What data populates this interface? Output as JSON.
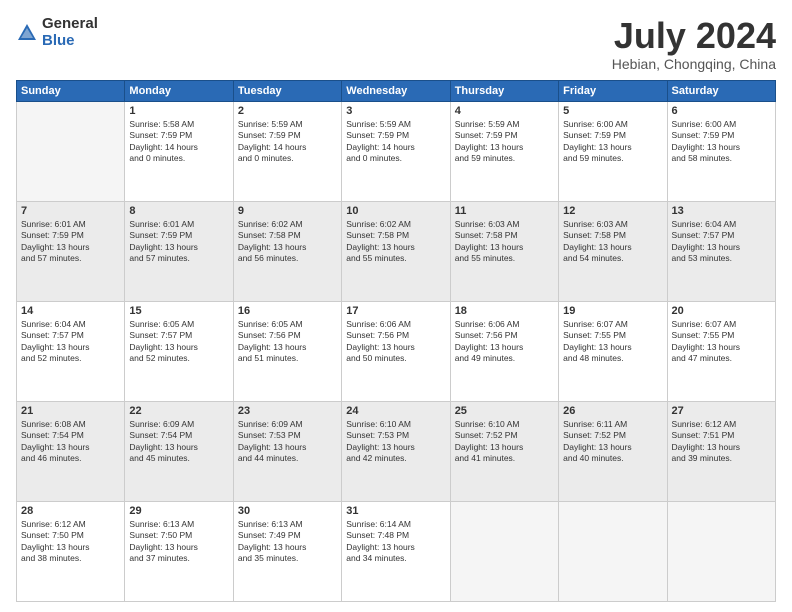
{
  "logo": {
    "general": "General",
    "blue": "Blue"
  },
  "title": {
    "month_year": "July 2024",
    "location": "Hebian, Chongqing, China"
  },
  "headers": [
    "Sunday",
    "Monday",
    "Tuesday",
    "Wednesday",
    "Thursday",
    "Friday",
    "Saturday"
  ],
  "weeks": [
    [
      {
        "day": "",
        "sunrise": "",
        "sunset": "",
        "daylight": ""
      },
      {
        "day": "1",
        "sunrise": "Sunrise: 5:58 AM",
        "sunset": "Sunset: 7:59 PM",
        "daylight": "Daylight: 14 hours and 0 minutes."
      },
      {
        "day": "2",
        "sunrise": "Sunrise: 5:59 AM",
        "sunset": "Sunset: 7:59 PM",
        "daylight": "Daylight: 14 hours and 0 minutes."
      },
      {
        "day": "3",
        "sunrise": "Sunrise: 5:59 AM",
        "sunset": "Sunset: 7:59 PM",
        "daylight": "Daylight: 14 hours and 0 minutes."
      },
      {
        "day": "4",
        "sunrise": "Sunrise: 5:59 AM",
        "sunset": "Sunset: 7:59 PM",
        "daylight": "Daylight: 13 hours and 59 minutes."
      },
      {
        "day": "5",
        "sunrise": "Sunrise: 6:00 AM",
        "sunset": "Sunset: 7:59 PM",
        "daylight": "Daylight: 13 hours and 59 minutes."
      },
      {
        "day": "6",
        "sunrise": "Sunrise: 6:00 AM",
        "sunset": "Sunset: 7:59 PM",
        "daylight": "Daylight: 13 hours and 58 minutes."
      }
    ],
    [
      {
        "day": "7",
        "sunrise": "Sunrise: 6:01 AM",
        "sunset": "Sunset: 7:59 PM",
        "daylight": "Daylight: 13 hours and 57 minutes."
      },
      {
        "day": "8",
        "sunrise": "Sunrise: 6:01 AM",
        "sunset": "Sunset: 7:59 PM",
        "daylight": "Daylight: 13 hours and 57 minutes."
      },
      {
        "day": "9",
        "sunrise": "Sunrise: 6:02 AM",
        "sunset": "Sunset: 7:58 PM",
        "daylight": "Daylight: 13 hours and 56 minutes."
      },
      {
        "day": "10",
        "sunrise": "Sunrise: 6:02 AM",
        "sunset": "Sunset: 7:58 PM",
        "daylight": "Daylight: 13 hours and 55 minutes."
      },
      {
        "day": "11",
        "sunrise": "Sunrise: 6:03 AM",
        "sunset": "Sunset: 7:58 PM",
        "daylight": "Daylight: 13 hours and 55 minutes."
      },
      {
        "day": "12",
        "sunrise": "Sunrise: 6:03 AM",
        "sunset": "Sunset: 7:58 PM",
        "daylight": "Daylight: 13 hours and 54 minutes."
      },
      {
        "day": "13",
        "sunrise": "Sunrise: 6:04 AM",
        "sunset": "Sunset: 7:57 PM",
        "daylight": "Daylight: 13 hours and 53 minutes."
      }
    ],
    [
      {
        "day": "14",
        "sunrise": "Sunrise: 6:04 AM",
        "sunset": "Sunset: 7:57 PM",
        "daylight": "Daylight: 13 hours and 52 minutes."
      },
      {
        "day": "15",
        "sunrise": "Sunrise: 6:05 AM",
        "sunset": "Sunset: 7:57 PM",
        "daylight": "Daylight: 13 hours and 52 minutes."
      },
      {
        "day": "16",
        "sunrise": "Sunrise: 6:05 AM",
        "sunset": "Sunset: 7:56 PM",
        "daylight": "Daylight: 13 hours and 51 minutes."
      },
      {
        "day": "17",
        "sunrise": "Sunrise: 6:06 AM",
        "sunset": "Sunset: 7:56 PM",
        "daylight": "Daylight: 13 hours and 50 minutes."
      },
      {
        "day": "18",
        "sunrise": "Sunrise: 6:06 AM",
        "sunset": "Sunset: 7:56 PM",
        "daylight": "Daylight: 13 hours and 49 minutes."
      },
      {
        "day": "19",
        "sunrise": "Sunrise: 6:07 AM",
        "sunset": "Sunset: 7:55 PM",
        "daylight": "Daylight: 13 hours and 48 minutes."
      },
      {
        "day": "20",
        "sunrise": "Sunrise: 6:07 AM",
        "sunset": "Sunset: 7:55 PM",
        "daylight": "Daylight: 13 hours and 47 minutes."
      }
    ],
    [
      {
        "day": "21",
        "sunrise": "Sunrise: 6:08 AM",
        "sunset": "Sunset: 7:54 PM",
        "daylight": "Daylight: 13 hours and 46 minutes."
      },
      {
        "day": "22",
        "sunrise": "Sunrise: 6:09 AM",
        "sunset": "Sunset: 7:54 PM",
        "daylight": "Daylight: 13 hours and 45 minutes."
      },
      {
        "day": "23",
        "sunrise": "Sunrise: 6:09 AM",
        "sunset": "Sunset: 7:53 PM",
        "daylight": "Daylight: 13 hours and 44 minutes."
      },
      {
        "day": "24",
        "sunrise": "Sunrise: 6:10 AM",
        "sunset": "Sunset: 7:53 PM",
        "daylight": "Daylight: 13 hours and 42 minutes."
      },
      {
        "day": "25",
        "sunrise": "Sunrise: 6:10 AM",
        "sunset": "Sunset: 7:52 PM",
        "daylight": "Daylight: 13 hours and 41 minutes."
      },
      {
        "day": "26",
        "sunrise": "Sunrise: 6:11 AM",
        "sunset": "Sunset: 7:52 PM",
        "daylight": "Daylight: 13 hours and 40 minutes."
      },
      {
        "day": "27",
        "sunrise": "Sunrise: 6:12 AM",
        "sunset": "Sunset: 7:51 PM",
        "daylight": "Daylight: 13 hours and 39 minutes."
      }
    ],
    [
      {
        "day": "28",
        "sunrise": "Sunrise: 6:12 AM",
        "sunset": "Sunset: 7:50 PM",
        "daylight": "Daylight: 13 hours and 38 minutes."
      },
      {
        "day": "29",
        "sunrise": "Sunrise: 6:13 AM",
        "sunset": "Sunset: 7:50 PM",
        "daylight": "Daylight: 13 hours and 37 minutes."
      },
      {
        "day": "30",
        "sunrise": "Sunrise: 6:13 AM",
        "sunset": "Sunset: 7:49 PM",
        "daylight": "Daylight: 13 hours and 35 minutes."
      },
      {
        "day": "31",
        "sunrise": "Sunrise: 6:14 AM",
        "sunset": "Sunset: 7:48 PM",
        "daylight": "Daylight: 13 hours and 34 minutes."
      },
      {
        "day": "",
        "sunrise": "",
        "sunset": "",
        "daylight": ""
      },
      {
        "day": "",
        "sunrise": "",
        "sunset": "",
        "daylight": ""
      },
      {
        "day": "",
        "sunrise": "",
        "sunset": "",
        "daylight": ""
      }
    ]
  ]
}
